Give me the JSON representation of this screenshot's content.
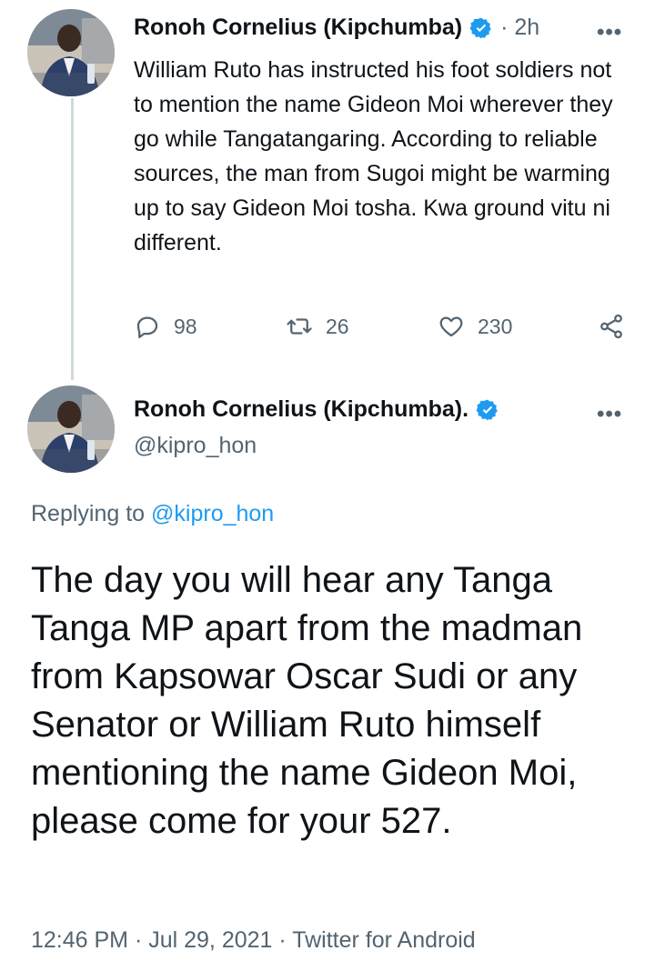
{
  "tweet1": {
    "author_name": "Ronoh Cornelius (Kipchumba)",
    "time": "· 2h",
    "text": "William Ruto has instructed his foot soldiers not to mention the name Gideon Moi wherever they go while Tangatangaring. According to reliable sources, the man from Sugoi might be warming up to say Gideon Moi tosha. Kwa ground vitu ni different.",
    "replies": "98",
    "retweets": "26",
    "likes": "230",
    "more": "•••"
  },
  "tweet2": {
    "author_name": "Ronoh Cornelius (Kipchumba).",
    "handle": "@kipro_hon",
    "more": "•••",
    "replying_prefix": "Replying to",
    "replying_to": "@kipro_hon",
    "text": "The day you will hear any Tanga Tanga MP apart from the madman from Kapsowar Oscar Sudi or any Senator or William Ruto himself mentioning the name Gideon Moi, please come for your 527.",
    "timestamp": "12:46 PM · Jul 29, 2021 · Twitter for Android"
  },
  "colors": {
    "accent": "#1d9bf0",
    "secondary_text": "#536471",
    "primary_text": "#0f1419",
    "thread_line": "#cfd9de"
  },
  "icons": [
    "verified-badge-icon",
    "more-icon",
    "reply-icon",
    "retweet-icon",
    "like-icon",
    "share-icon"
  ]
}
